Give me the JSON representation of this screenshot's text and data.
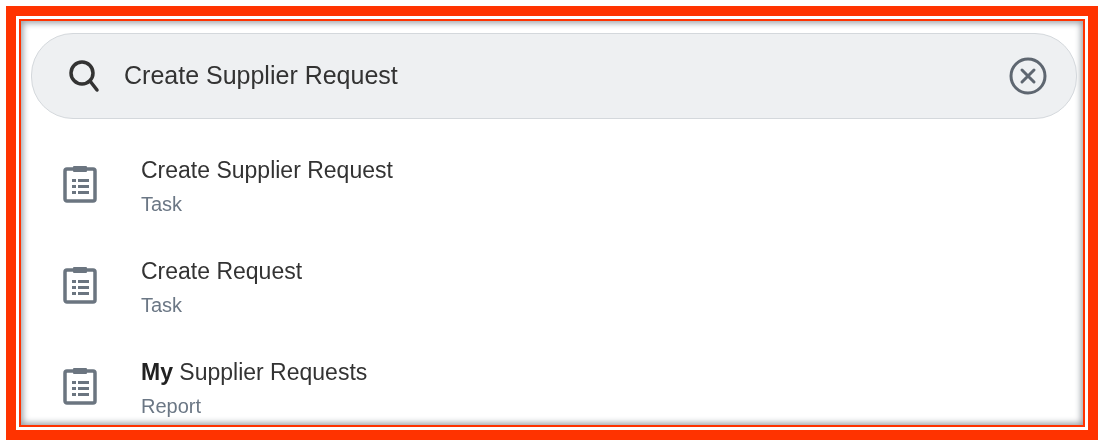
{
  "search": {
    "value": "Create Supplier Request"
  },
  "results": [
    {
      "title": "Create Supplier Request",
      "type": "Task"
    },
    {
      "title": "Create Request",
      "type": "Task"
    },
    {
      "title": "**My** Supplier Requests",
      "type": "Report"
    }
  ]
}
